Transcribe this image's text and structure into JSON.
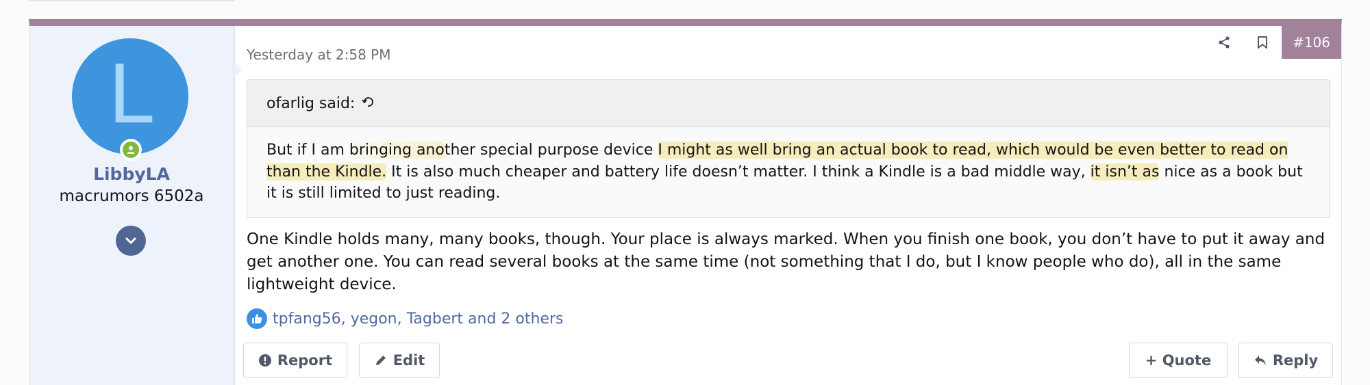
{
  "user": {
    "avatar_letter": "L",
    "username": "LibbyLA",
    "title": "macrumors 6502a"
  },
  "post": {
    "timestamp": "Yesterday at 2:58 PM",
    "number": "#106"
  },
  "quote": {
    "author_label": "ofarlig said:",
    "text_part1": "But if I am ",
    "text_part2": "bringing ano",
    "text_part3": "ther special purpose device ",
    "text_highlight": "I might as well bring an actual book to read, which would be even better to read on than the Kindle.",
    "text_part4": " It is also much cheaper and battery life doesn’t matter. I think a Kindle is a bad middle way, ",
    "text_highlight2": "it isn’t as",
    "text_part5": " nice as a book but it is still limited to just reading."
  },
  "message": {
    "text": "One Kindle holds many, many books, though. Your place is always marked. When you finish one book, you don’t have to put it away and get another one. You can read several books at the same time (not something that I do, but I know people who do), all in the same lightweight device."
  },
  "reactions": {
    "text": "tpfang56, yegon, Tagbert and 2 others"
  },
  "buttons": {
    "report": "Report",
    "edit": "Edit",
    "quote": "+ Quote",
    "reply": "Reply"
  },
  "colors": {
    "accent": "#a2819b",
    "avatar": "#3f95dd",
    "link": "#4f6aa0",
    "online": "#7fba3f"
  },
  "icons": {
    "share": "share-icon",
    "bookmark": "bookmark-icon",
    "online": "user-online-icon",
    "expand": "chevron-down-icon",
    "jump": "jump-to-quote-icon",
    "like": "thumbs-up-icon",
    "report": "exclamation-circle-icon",
    "edit": "pencil-icon",
    "reply": "reply-arrow-icon"
  }
}
